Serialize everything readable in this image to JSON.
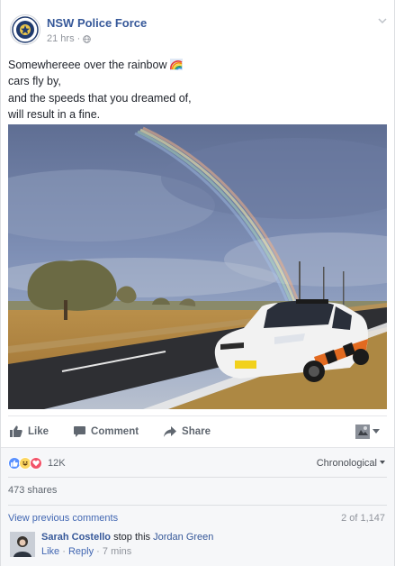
{
  "post": {
    "page_name": "NSW Police Force",
    "time": "21 hrs",
    "privacy_icon": "globe-icon",
    "lines": [
      "Somewhereee over the rainbow",
      "cars fly by,",
      "and the speeds that you dreamed of,",
      "will result in a fine."
    ],
    "emoji": "rainbow-emoji"
  },
  "actions": {
    "like": "Like",
    "comment": "Comment",
    "share": "Share"
  },
  "feedback": {
    "reaction_count": "12K",
    "order": "Chronological",
    "shares": "473 shares",
    "view_previous": "View previous comments",
    "pager": "2 of 1,147"
  },
  "comment": {
    "author": "Sarah Costello",
    "text": "stop this",
    "tag": "Jordan Green",
    "like": "Like",
    "reply": "Reply",
    "sep": "·",
    "time": "7 mins"
  },
  "colors": {
    "link": "#365899",
    "like_blue": "#5890ff",
    "love_red": "#f25268",
    "haha_yellow": "#fcd660"
  }
}
